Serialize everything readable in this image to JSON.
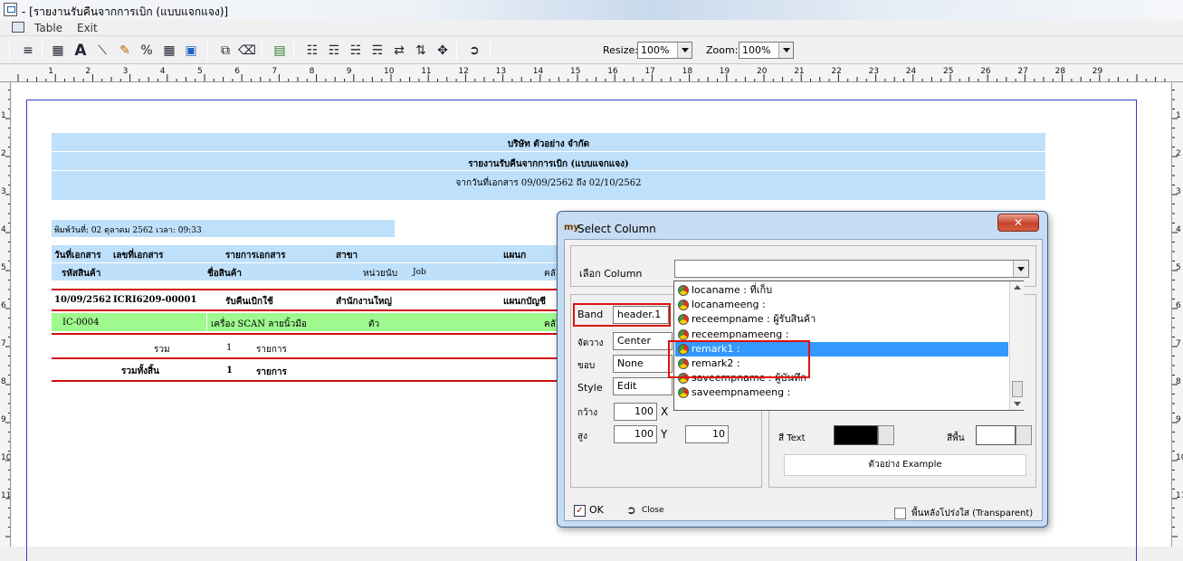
{
  "window": {
    "title": "- [รายงานรับคืนจากการเบิก (แบบแจกแจง)]"
  },
  "menu": {
    "items": [
      "Table",
      "Exit"
    ]
  },
  "toolbar": {
    "resize_label": "Resize:",
    "resize_value": "100%",
    "zoom_label": "Zoom:",
    "zoom_value": "100%"
  },
  "ruler": {
    "h_numbers": [
      "1",
      "2",
      "3",
      "4",
      "5",
      "6",
      "7",
      "8",
      "9",
      "10",
      "11",
      "12",
      "13",
      "14",
      "15",
      "16",
      "17",
      "18",
      "19",
      "20",
      "21",
      "22",
      "23",
      "24",
      "25",
      "26",
      "27",
      "28",
      "29"
    ],
    "v_numbers": [
      "1",
      "2",
      "3",
      "4",
      "5",
      "6",
      "7",
      "8",
      "9",
      "10",
      "11"
    ]
  },
  "report": {
    "company": "บริษัท ตัวอย่าง จำกัด",
    "title": "รายงานรับคืนจากการเบิก (แบบแจกแจง)",
    "date_range": "จากวันที่เอกสาร 09/09/2562 ถึง 02/10/2562",
    "print_date": "พิมพ์วันที่: 02 ตุลาคม 2562 เวลา: 09:33",
    "header_row1": [
      "วันที่เอกสาร",
      "เลขที่เอกสาร",
      "รายการเอกสาร",
      "สาขา",
      "แผนก"
    ],
    "header_row2": [
      "รหัสสินค้า",
      "ชื่อสินค้า",
      "หน่วยนับ",
      "Job",
      "คลั"
    ],
    "doc_row": [
      "10/09/2562",
      "ICRI6209-00001",
      "รับคืนเบิกใช้",
      "สำนักงานใหญ่",
      "แผนกบัญชี"
    ],
    "item_row": [
      "IC-0004",
      "เครื่อง SCAN ลายนิ้วมือ",
      "ตัว",
      "คลั"
    ],
    "subtotal": [
      "รวม",
      "1",
      "รายการ"
    ],
    "grandtotal": [
      "รวมทั้งสิ้น",
      "1",
      "รายการ"
    ]
  },
  "dialog": {
    "title": "Select Column",
    "select_label": "เลือก Column",
    "select_value": "",
    "band_label": "Band",
    "band_value": "header.1",
    "align_label": "จัดวาง",
    "align_value": "Center",
    "border_label": "ขอบ",
    "border_value": "None",
    "style_label": "Style",
    "style_value": "Edit",
    "width_label": "กว้าง",
    "width_value": "100",
    "x_label": "X",
    "height_label": "สูง",
    "height_value": "100",
    "y_label": "Y",
    "y_value": "10",
    "text_color_label": "สี Text",
    "bg_color_label": "สีพื้น",
    "example_text": "ตัวอย่าง Example",
    "ok_label": "OK",
    "close_label": "Close",
    "transparent_label": "พื้นหลังโปร่งใส (Transparent)",
    "options": [
      "locaname : ที่เก็บ",
      "locanameeng :",
      "receempname : ผู้รับสินค้า",
      "receempnameeng :",
      "remark1 :",
      "remark2 :",
      "saveempname : ผู้บันทึก",
      "saveempnameeng :"
    ],
    "selected_option": "remark1 :"
  },
  "colors": {
    "band": "#bfe0fb",
    "item_row": "#9ef98f",
    "highlight": "#e01010",
    "selection": "#3399ff"
  }
}
